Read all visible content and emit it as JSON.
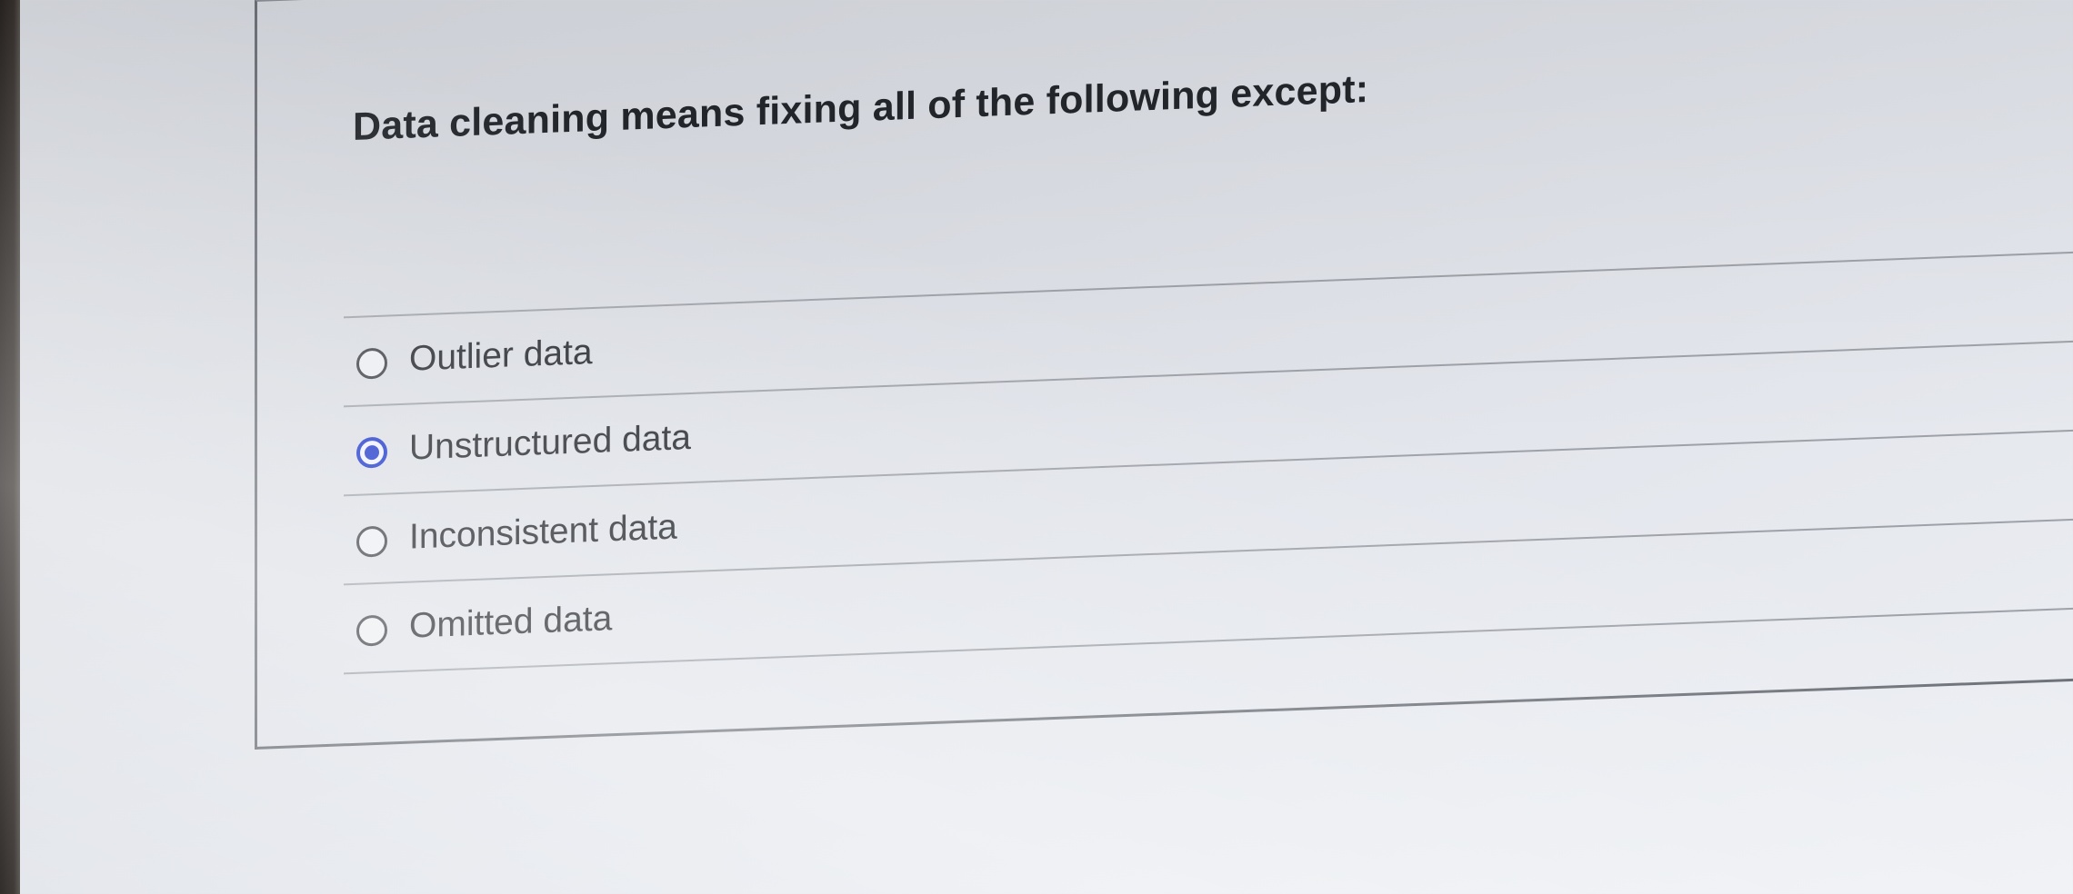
{
  "question": {
    "text": "Data cleaning means fixing all of the following except:"
  },
  "options": [
    {
      "label": "Outlier data",
      "selected": false
    },
    {
      "label": "Unstructured data",
      "selected": true
    },
    {
      "label": "Inconsistent data",
      "selected": false
    },
    {
      "label": "Omitted data",
      "selected": false
    }
  ],
  "colors": {
    "selected_radio": "#1b36c9",
    "text": "#23262b",
    "border": "#6c7077"
  }
}
